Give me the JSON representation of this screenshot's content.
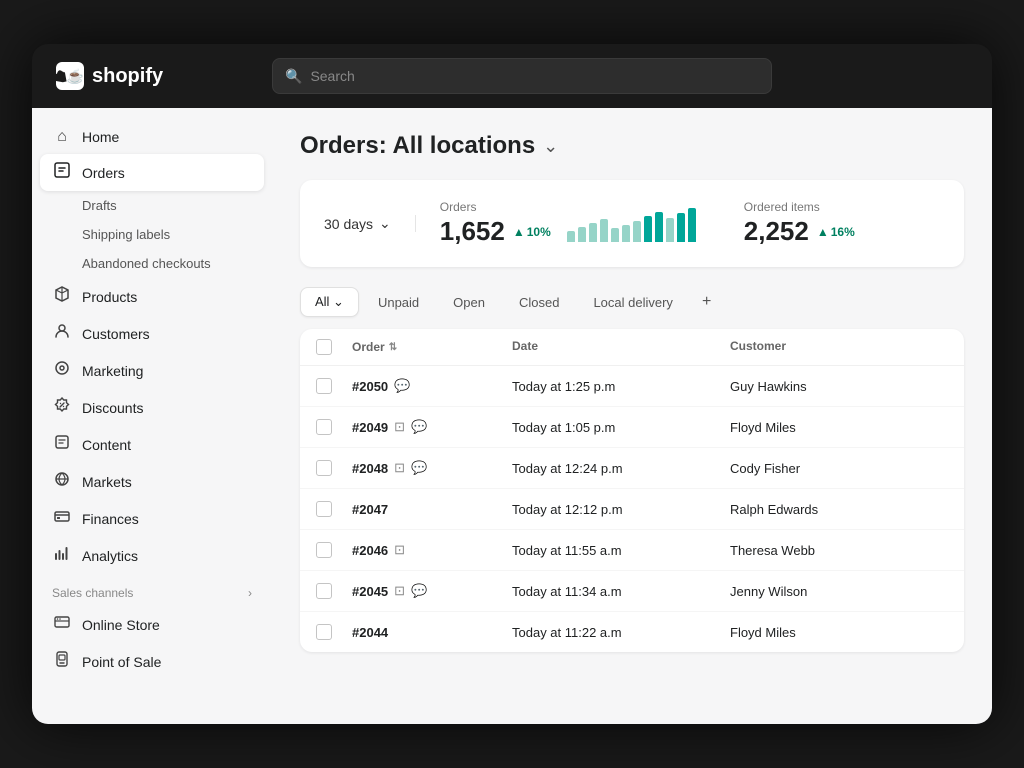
{
  "topbar": {
    "logo_text": "shopify",
    "search_placeholder": "Search"
  },
  "sidebar": {
    "items": [
      {
        "id": "home",
        "label": "Home",
        "icon": "🏠"
      },
      {
        "id": "orders",
        "label": "Orders",
        "icon": "◻",
        "active": true
      },
      {
        "id": "products",
        "label": "Products",
        "icon": "🏷"
      },
      {
        "id": "customers",
        "label": "Customers",
        "icon": "👤"
      },
      {
        "id": "marketing",
        "label": "Marketing",
        "icon": "📣"
      },
      {
        "id": "discounts",
        "label": "Discounts",
        "icon": "🏷"
      },
      {
        "id": "content",
        "label": "Content",
        "icon": "🖥"
      },
      {
        "id": "markets",
        "label": "Markets",
        "icon": "🌐"
      },
      {
        "id": "finances",
        "label": "Finances",
        "icon": "🏛"
      },
      {
        "id": "analytics",
        "label": "Analytics",
        "icon": "📊"
      }
    ],
    "sub_items": [
      {
        "id": "drafts",
        "label": "Drafts"
      },
      {
        "id": "shipping-labels",
        "label": "Shipping labels"
      },
      {
        "id": "abandoned-checkouts",
        "label": "Abandoned checkouts"
      }
    ],
    "sales_channels_label": "Sales channels",
    "sales_channels": [
      {
        "id": "online-store",
        "label": "Online Store",
        "icon": "🖥"
      },
      {
        "id": "point-of-sale",
        "label": "Point of Sale",
        "icon": "🛍"
      }
    ]
  },
  "page": {
    "title": "Orders: All locations",
    "period": "30 days",
    "stats": {
      "orders_label": "Orders",
      "orders_value": "1,652",
      "orders_badge": "10%",
      "items_label": "Ordered items",
      "items_value": "2,252",
      "items_badge": "16%"
    },
    "tabs": [
      {
        "id": "all",
        "label": "All",
        "active": true
      },
      {
        "id": "unpaid",
        "label": "Unpaid",
        "active": false
      },
      {
        "id": "open",
        "label": "Open",
        "active": false
      },
      {
        "id": "closed",
        "label": "Closed",
        "active": false
      },
      {
        "id": "local-delivery",
        "label": "Local delivery",
        "active": false
      }
    ],
    "table": {
      "headers": [
        "",
        "Order",
        "Date",
        "Customer"
      ],
      "rows": [
        {
          "order": "#2050",
          "has_msg": true,
          "has_note": false,
          "date": "Today at 1:25 p.m",
          "customer": "Guy Hawkins"
        },
        {
          "order": "#2049",
          "has_msg": true,
          "has_note": true,
          "date": "Today at 1:05 p.m",
          "customer": "Floyd Miles"
        },
        {
          "order": "#2048",
          "has_msg": true,
          "has_note": true,
          "date": "Today at 12:24 p.m",
          "customer": "Cody Fisher"
        },
        {
          "order": "#2047",
          "has_msg": false,
          "has_note": false,
          "date": "Today at 12:12 p.m",
          "customer": "Ralph Edwards"
        },
        {
          "order": "#2046",
          "has_msg": false,
          "has_note": true,
          "date": "Today at 11:55 a.m",
          "customer": "Theresa Webb"
        },
        {
          "order": "#2045",
          "has_msg": true,
          "has_note": true,
          "date": "Today at 11:34 a.m",
          "customer": "Jenny Wilson"
        },
        {
          "order": "#2044",
          "has_msg": false,
          "has_note": false,
          "date": "Today at 11:22 a.m",
          "customer": "Floyd Miles"
        }
      ]
    }
  },
  "chart": {
    "bars": [
      15,
      20,
      25,
      30,
      18,
      22,
      28,
      35,
      40,
      32,
      38,
      45
    ]
  }
}
